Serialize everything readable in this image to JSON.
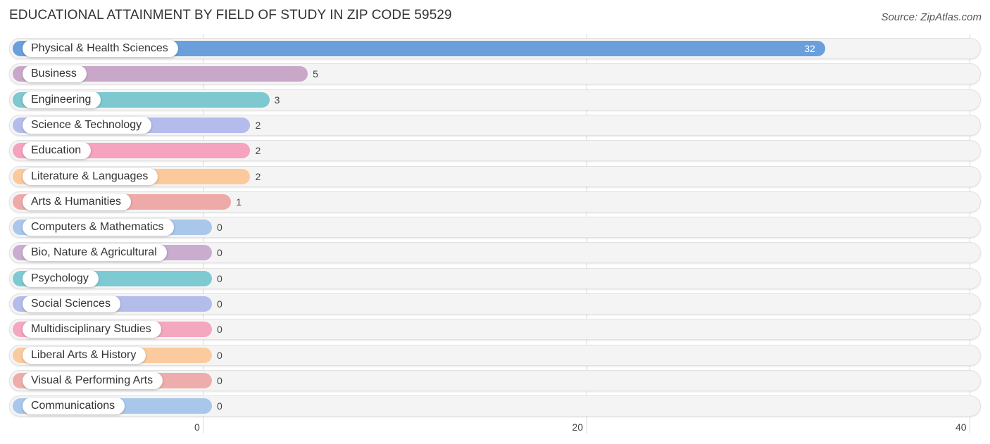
{
  "title": "EDUCATIONAL ATTAINMENT BY FIELD OF STUDY IN ZIP CODE 59529",
  "source": "Source: ZipAtlas.com",
  "chart_data": {
    "type": "bar",
    "orientation": "horizontal",
    "title": "EDUCATIONAL ATTAINMENT BY FIELD OF STUDY IN ZIP CODE 59529",
    "xlabel": "",
    "ylabel": "",
    "xlim": [
      0,
      40
    ],
    "xticks": [
      0,
      20,
      40
    ],
    "xtick_labels": [
      "0",
      "20",
      "40"
    ],
    "grid": true,
    "categories": [
      "Physical & Health Sciences",
      "Business",
      "Engineering",
      "Science & Technology",
      "Education",
      "Literature & Languages",
      "Arts & Humanities",
      "Computers & Mathematics",
      "Bio, Nature & Agricultural",
      "Psychology",
      "Social Sciences",
      "Multidisciplinary Studies",
      "Liberal Arts & History",
      "Visual & Performing Arts",
      "Communications"
    ],
    "values": [
      32,
      5,
      3,
      2,
      2,
      2,
      1,
      0,
      0,
      0,
      0,
      0,
      0,
      0,
      0
    ],
    "value_labels": [
      "32",
      "5",
      "3",
      "2",
      "2",
      "2",
      "1",
      "0",
      "0",
      "0",
      "0",
      "0",
      "0",
      "0",
      "0"
    ],
    "colors": [
      "#6a9fdc",
      "#c9a7c9",
      "#7ec8cf",
      "#b3bcea",
      "#f5a3be",
      "#fbc99b",
      "#eeaaa8",
      "#a9c7eb",
      "#c9acd0",
      "#7ecad3",
      "#b3bcea",
      "#f5a7c0",
      "#fbcb9f",
      "#eeadab",
      "#a9c7eb"
    ]
  }
}
